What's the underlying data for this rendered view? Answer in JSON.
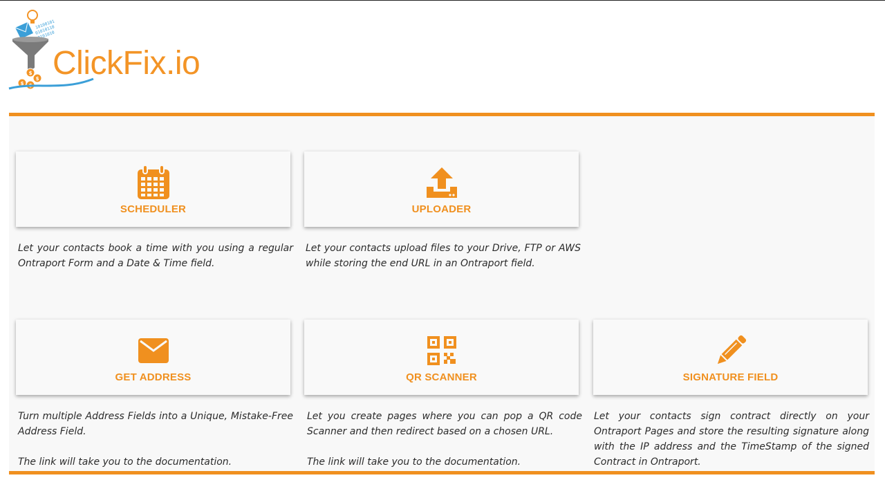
{
  "logo": {
    "text": "ClickFix.io",
    "binary_1": "10100101",
    "binary_2": "01010110",
    "binary_3": "10101010"
  },
  "colors": {
    "accent": "#f0901f",
    "panel_bg": "#f8f8f8",
    "text": "#2b2b2b",
    "logo_blue": "#3b9fd8",
    "logo_gray": "#7a7a7a"
  },
  "cards": [
    {
      "icon": "calendar-icon",
      "title": "SCHEDULER",
      "paragraphs": [
        "Let your contacts book a time with you using a regular Ontraport Form and a Date & Time field."
      ]
    },
    {
      "icon": "upload-icon",
      "title": "UPLOADER",
      "paragraphs": [
        "Let your contacts upload files to your  Drive, FTP or AWS while storing the end URL in an Ontraport field."
      ]
    },
    {
      "icon": "envelope-icon",
      "title": "GET ADDRESS",
      "paragraphs": [
        "Turn multiple Address Fields into a Unique, Mistake-Free Address Field.",
        "The link will take you to the documentation."
      ]
    },
    {
      "icon": "qr-code-icon",
      "title": "QR SCANNER",
      "paragraphs": [
        "Let you create pages where you can pop a QR code Scanner and then redirect based on a chosen URL.",
        "The link will take you to the documentation."
      ]
    },
    {
      "icon": "pencil-icon",
      "title": "SIGNATURE FIELD",
      "paragraphs": [
        "Let your contacts sign contract directly on your Ontraport Pages and store the resulting signature along with the IP address and the TimeStamp of the signed Contract in Ontraport."
      ]
    }
  ]
}
